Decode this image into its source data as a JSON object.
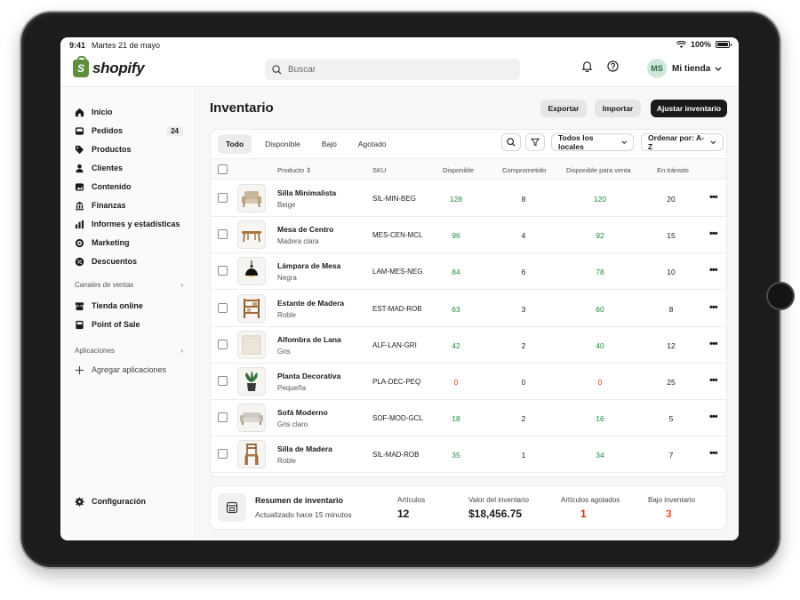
{
  "status_bar": {
    "time": "9:41",
    "date": "Martes 21 de mayo",
    "battery": "100%"
  },
  "brand": {
    "name": "shopify",
    "color": "#5e8e3e"
  },
  "search": {
    "placeholder": "Buscar"
  },
  "account": {
    "initials": "MS",
    "store": "Mi tienda"
  },
  "sidebar": {
    "items": [
      {
        "label": "Inicio",
        "icon": "home-icon"
      },
      {
        "label": "Pedidos",
        "icon": "inbox-icon",
        "badge": "24"
      },
      {
        "label": "Productos",
        "icon": "tag-icon"
      },
      {
        "label": "Clientes",
        "icon": "person-icon"
      },
      {
        "label": "Contenido",
        "icon": "content-icon"
      },
      {
        "label": "Finanzas",
        "icon": "bank-icon"
      },
      {
        "label": "Informes y estadísticas",
        "icon": "bar-chart-icon"
      },
      {
        "label": "Marketing",
        "icon": "target-icon"
      },
      {
        "label": "Descuentos",
        "icon": "discount-icon"
      }
    ],
    "channels_title": "Canales de ventas",
    "channels": [
      {
        "label": "Tienda online",
        "icon": "store-icon"
      },
      {
        "label": "Point of Sale",
        "icon": "pos-icon"
      }
    ],
    "apps_title": "Aplicaciones",
    "add_apps": "Agregar aplicaciones",
    "settings": "Configuración"
  },
  "page": {
    "title": "Inventario",
    "export": "Exportar",
    "import": "Importar",
    "adjust": "Ajustar inventario"
  },
  "tabs": [
    "Todo",
    "Disponible",
    "Bajo",
    "Agotado"
  ],
  "filters": {
    "locations": "Todos los locales",
    "sort": "Ordenar por: A-Z"
  },
  "columns": {
    "product": "Producto",
    "sku": "SKU",
    "available": "Disponible",
    "committed": "Comprometido",
    "for_sale": "Disponible para venta",
    "in_transit": "En tránsito"
  },
  "rows": [
    {
      "name": "Silla Minimalista",
      "variant": "Beige",
      "sku": "SIL-MIN-BEG",
      "available": "128",
      "committed": "8",
      "for_sale": "120",
      "in_transit": "20",
      "icon": "armchair-icon"
    },
    {
      "name": "Mesa de Centro",
      "variant": "Madera clara",
      "sku": "MES-CEN-MCL",
      "available": "96",
      "committed": "4",
      "for_sale": "92",
      "in_transit": "15",
      "icon": "table-icon"
    },
    {
      "name": "Lámpara de Mesa",
      "variant": "Negra",
      "sku": "LAM-MES-NEG",
      "available": "84",
      "committed": "6",
      "for_sale": "78",
      "in_transit": "10",
      "icon": "lamp-icon"
    },
    {
      "name": "Estante de Madera",
      "variant": "Roble",
      "sku": "EST-MAD-ROB",
      "available": "63",
      "committed": "3",
      "for_sale": "60",
      "in_transit": "8",
      "icon": "shelf-icon"
    },
    {
      "name": "Alfombra de Lana",
      "variant": "Gris",
      "sku": "ALF-LAN-GRI",
      "available": "42",
      "committed": "2",
      "for_sale": "40",
      "in_transit": "12",
      "icon": "rug-icon"
    },
    {
      "name": "Planta Decorativa",
      "variant": "Pequeña",
      "sku": "PLA-DEC-PEQ",
      "available": "0",
      "committed": "0",
      "for_sale": "0",
      "in_transit": "25",
      "icon": "plant-icon"
    },
    {
      "name": "Sofá Moderno",
      "variant": "Gris claro",
      "sku": "SOF-MOD-GCL",
      "available": "18",
      "committed": "2",
      "for_sale": "16",
      "in_transit": "5",
      "icon": "sofa-icon"
    },
    {
      "name": "Silla de Madera",
      "variant": "Roble",
      "sku": "SIL-MAD-ROB",
      "available": "35",
      "committed": "1",
      "for_sale": "34",
      "in_transit": "7",
      "icon": "wood-chair-icon"
    }
  ],
  "summary": {
    "title": "Resumen de inventario",
    "updated": "Actualizado hace 15 minutos",
    "items_label": "Artículos",
    "items_value": "12",
    "value_label": "Valor del inventario",
    "value_value": "$18,456.75",
    "out_label": "Artículos agotados",
    "out_value": "1",
    "low_label": "Bajo inventario",
    "low_value": "3"
  },
  "colors": {
    "positive": "#1e8a3e",
    "negative": "#d72c0d",
    "low": "#e4572e"
  }
}
